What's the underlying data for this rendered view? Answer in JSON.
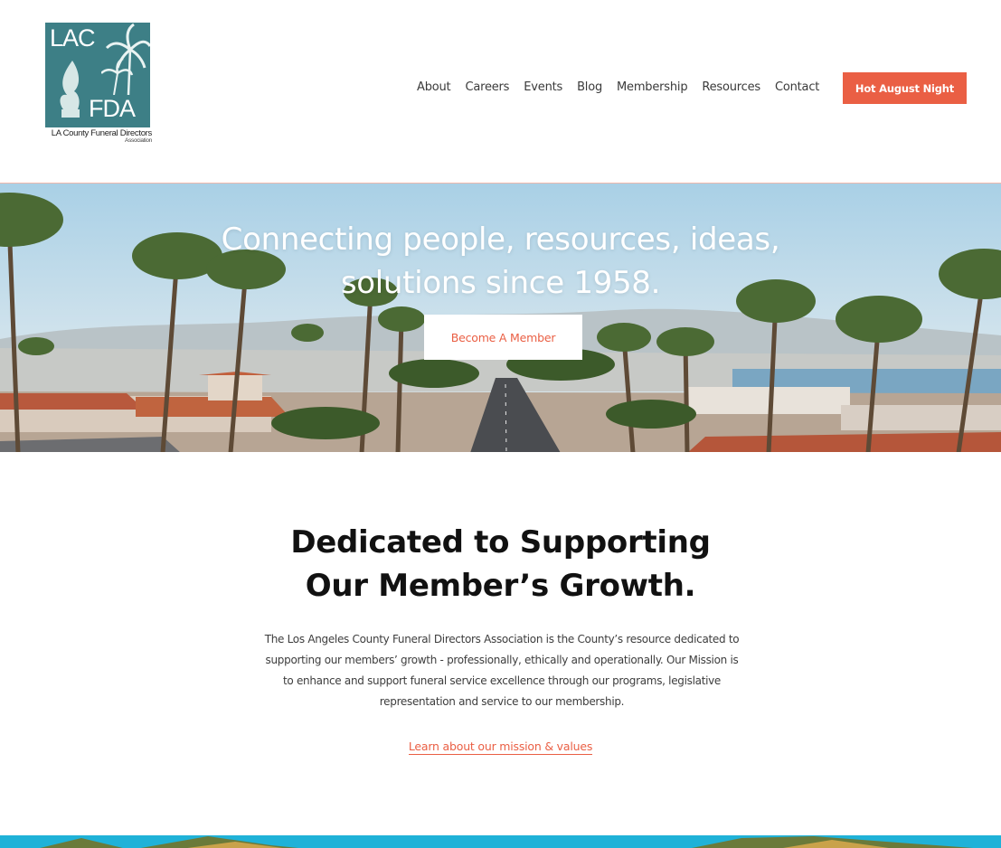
{
  "logo": {
    "top_text": "LAC",
    "bottom_text": "FDA",
    "caption": "LA County Funeral Directors",
    "caption_sub": "Association",
    "icon": "flame-palm-logo-icon"
  },
  "nav": {
    "items": [
      {
        "label": "About"
      },
      {
        "label": "Careers"
      },
      {
        "label": "Events"
      },
      {
        "label": "Blog"
      },
      {
        "label": "Membership"
      },
      {
        "label": "Resources"
      },
      {
        "label": "Contact"
      }
    ],
    "cta_label": "Hot August Night"
  },
  "hero": {
    "title_line1": "Connecting people, resources, ideas,",
    "title_line2": "solutions since 1958.",
    "button_label": "Become A Member"
  },
  "about": {
    "title_line1": "Dedicated to Supporting",
    "title_line2": "Our Member’s Growth.",
    "body": "The Los Angeles County Funeral Directors Association is the County’s resource dedicated to supporting our members’ growth - professionally, ethically and operationally. Our Mission is to enhance and support funeral service excellence through our programs, legislative representation and service to our membership.",
    "link_label": "Learn about our mission & values"
  },
  "colors": {
    "accent": "#ea5f44",
    "logo_teal": "#3d7f86",
    "banner_blue": "#1fb2d8"
  }
}
